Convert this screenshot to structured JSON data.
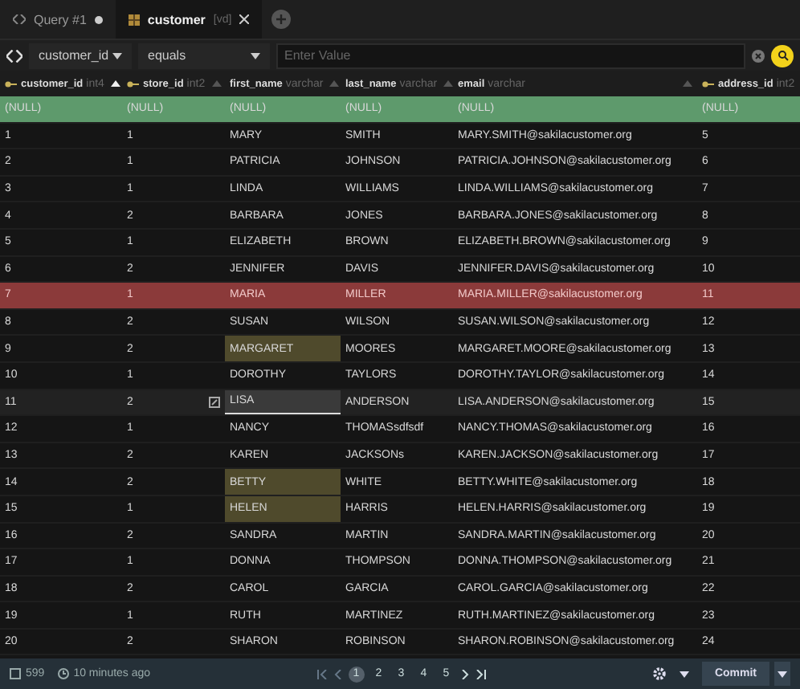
{
  "tabs": [
    {
      "kind": "query",
      "label": "Query #1",
      "unsaved": true,
      "selected": false
    },
    {
      "kind": "table",
      "label": "customer",
      "schema": "[vd]",
      "selected": true
    }
  ],
  "filter": {
    "column": "customer_id",
    "operator": "equals",
    "placeholder": "Enter Value"
  },
  "columns": [
    {
      "name": "customer_id",
      "type": "int4",
      "key": true,
      "sorted": true
    },
    {
      "name": "store_id",
      "type": "int2",
      "key": true,
      "sorted": false
    },
    {
      "name": "first_name",
      "type": "varchar",
      "key": false,
      "sorted": false
    },
    {
      "name": "last_name",
      "type": "varchar",
      "key": false,
      "sorted": false
    },
    {
      "name": "email",
      "type": "varchar",
      "key": false,
      "sorted": false
    },
    {
      "name": "address_id",
      "type": "int2",
      "key": true
    }
  ],
  "rows": [
    {
      "kind": "new",
      "edited": false,
      "cells": [
        "(NULL)",
        "(NULL)",
        "(NULL)",
        "(NULL)",
        "(NULL)",
        "(NULL)"
      ]
    },
    {
      "kind": "normal",
      "edited": false,
      "cells": [
        "1",
        "1",
        "MARY",
        "SMITH",
        "MARY.SMITH@sakilacustomer.org",
        "5"
      ]
    },
    {
      "kind": "normal",
      "edited": false,
      "cells": [
        "2",
        "1",
        "PATRICIA",
        "JOHNSON",
        "PATRICIA.JOHNSON@sakilacustomer.org",
        "6"
      ]
    },
    {
      "kind": "normal",
      "edited": false,
      "cells": [
        "3",
        "1",
        "LINDA",
        "WILLIAMS",
        "LINDA.WILLIAMS@sakilacustomer.org",
        "7"
      ]
    },
    {
      "kind": "normal",
      "edited": false,
      "cells": [
        "4",
        "2",
        "BARBARA",
        "JONES",
        "BARBARA.JONES@sakilacustomer.org",
        "8"
      ]
    },
    {
      "kind": "normal",
      "edited": false,
      "cells": [
        "5",
        "1",
        "ELIZABETH",
        "BROWN",
        "ELIZABETH.BROWN@sakilacustomer.org",
        "9"
      ]
    },
    {
      "kind": "normal",
      "edited": false,
      "cells": [
        "6",
        "2",
        "JENNIFER",
        "DAVIS",
        "JENNIFER.DAVIS@sakilacustomer.org",
        "10"
      ]
    },
    {
      "kind": "deleted",
      "edited": false,
      "cells": [
        "7",
        "1",
        "MARIA",
        "MILLER",
        "MARIA.MILLER@sakilacustomer.org",
        "11"
      ]
    },
    {
      "kind": "normal",
      "edited": false,
      "cells": [
        "8",
        "2",
        "SUSAN",
        "WILSON",
        "SUSAN.WILSON@sakilacustomer.org",
        "12"
      ]
    },
    {
      "kind": "normal",
      "edited": true,
      "cells": [
        "9",
        "2",
        "MARGARET",
        "MOORES",
        "MARGARET.MOORE@sakilacustomer.org",
        "13"
      ]
    },
    {
      "kind": "normal",
      "edited": false,
      "cells": [
        "10",
        "1",
        "DOROTHY",
        "TAYLORS",
        "DOROTHY.TAYLOR@sakilacustomer.org",
        "14"
      ]
    },
    {
      "kind": "editing",
      "edited": false,
      "cells": [
        "11",
        "2",
        "LISA",
        "ANDERSON",
        "LISA.ANDERSON@sakilacustomer.org",
        "15"
      ]
    },
    {
      "kind": "normal",
      "edited": false,
      "cells": [
        "12",
        "1",
        "NANCY",
        "THOMASsdfsdf",
        "NANCY.THOMAS@sakilacustomer.org",
        "16"
      ]
    },
    {
      "kind": "normal",
      "edited": false,
      "cells": [
        "13",
        "2",
        "KAREN",
        "JACKSONs",
        "KAREN.JACKSON@sakilacustomer.org",
        "17"
      ]
    },
    {
      "kind": "normal",
      "edited": true,
      "cells": [
        "14",
        "2",
        "BETTY",
        "WHITE",
        "BETTY.WHITE@sakilacustomer.org",
        "18"
      ]
    },
    {
      "kind": "normal",
      "edited": true,
      "cells": [
        "15",
        "1",
        "HELEN",
        "HARRIS",
        "HELEN.HARRIS@sakilacustomer.org",
        "19"
      ]
    },
    {
      "kind": "normal",
      "edited": false,
      "cells": [
        "16",
        "2",
        "SANDRA",
        "MARTIN",
        "SANDRA.MARTIN@sakilacustomer.org",
        "20"
      ]
    },
    {
      "kind": "normal",
      "edited": false,
      "cells": [
        "17",
        "1",
        "DONNA",
        "THOMPSON",
        "DONNA.THOMPSON@sakilacustomer.org",
        "21"
      ]
    },
    {
      "kind": "normal",
      "edited": false,
      "cells": [
        "18",
        "2",
        "CAROL",
        "GARCIA",
        "CAROL.GARCIA@sakilacustomer.org",
        "22"
      ]
    },
    {
      "kind": "normal",
      "edited": false,
      "cells": [
        "19",
        "1",
        "RUTH",
        "MARTINEZ",
        "RUTH.MARTINEZ@sakilacustomer.org",
        "23"
      ]
    },
    {
      "kind": "normal",
      "edited": false,
      "cells": [
        "20",
        "2",
        "SHARON",
        "ROBINSON",
        "SHARON.ROBINSON@sakilacustomer.org",
        "24"
      ]
    }
  ],
  "footer": {
    "count": "599",
    "time": "10 minutes ago",
    "pages": [
      {
        "label": "1",
        "selected": true
      },
      {
        "label": "2",
        "selected": false
      },
      {
        "label": "3",
        "selected": false
      },
      {
        "label": "4",
        "selected": false
      },
      {
        "label": "5",
        "selected": false
      }
    ],
    "commit": "Commit"
  }
}
